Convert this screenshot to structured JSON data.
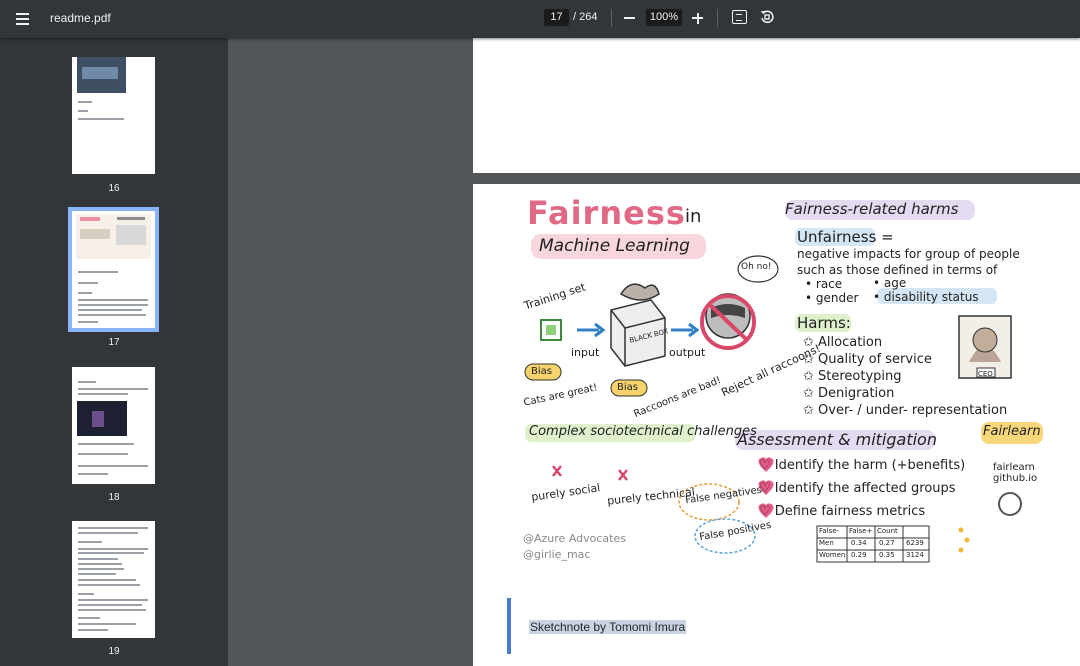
{
  "toolbar": {
    "file_name": "readme.pdf",
    "current_page": "17",
    "total_pages": "/ 264",
    "zoom": "100%"
  },
  "thumbnails": [
    {
      "page": "16",
      "lines": [
        "Recognition",
        "Fairness in Machine Learning"
      ]
    },
    {
      "page": "17"
    },
    {
      "page": "18"
    },
    {
      "page": "19"
    }
  ],
  "sketchnote": {
    "title_1": "Fairness",
    "title_2": "in",
    "title_3": "Machine Learning",
    "harms_heading": "Fairness-related harms",
    "unfairness": "Unfairness =",
    "unfair_desc_1": "negative impacts for group of people",
    "unfair_desc_2": "such as those defined in terms of",
    "attr_1": "• race",
    "attr_2": "• age",
    "attr_3": "• gender",
    "attr_4": "• disability status",
    "harms_label": "Harms:",
    "harm_1": "✩ Allocation",
    "harm_2": "✩ Quality of service",
    "harm_3": "✩ Stereotyping",
    "harm_4": "✩ Denigration",
    "harm_5": "✩ Over- / under- representation",
    "training_set": "Training set",
    "input": "input",
    "black_box": "BLACK BOX",
    "output": "output",
    "oh_no": "Oh no!",
    "reject": "Reject all raccoons!",
    "bias": "Bias",
    "cats_great": "Cats are great!",
    "raccoons_bad": "Raccoons are bad!",
    "ceo": "CEO",
    "complex": "Complex sociotechnical challenges",
    "purely_social": "purely social",
    "purely_technical": "purely technical",
    "assessment": "Assessment & mitigation",
    "step_1": "♡ Identify the harm (+benefits)",
    "step_2": "♡ Identify the affected groups",
    "step_3": "♡ Define fairness metrics",
    "false_neg": "False negatives",
    "false_pos": "False positives",
    "fairlearn": "Fairlearn",
    "fairlearn_url": "fairlearn github.io",
    "table_headers": [
      "",
      "False-",
      "False+",
      "Count"
    ],
    "table_rows": [
      [
        "Men",
        "0.34",
        "0.27",
        "6239"
      ],
      [
        "Women",
        "0.29",
        "0.35",
        "3124"
      ]
    ],
    "credit_1": "@Azure Advocates",
    "credit_2": "@girlie_mac"
  },
  "caption": "Sketchnote by Tomomi Imura"
}
